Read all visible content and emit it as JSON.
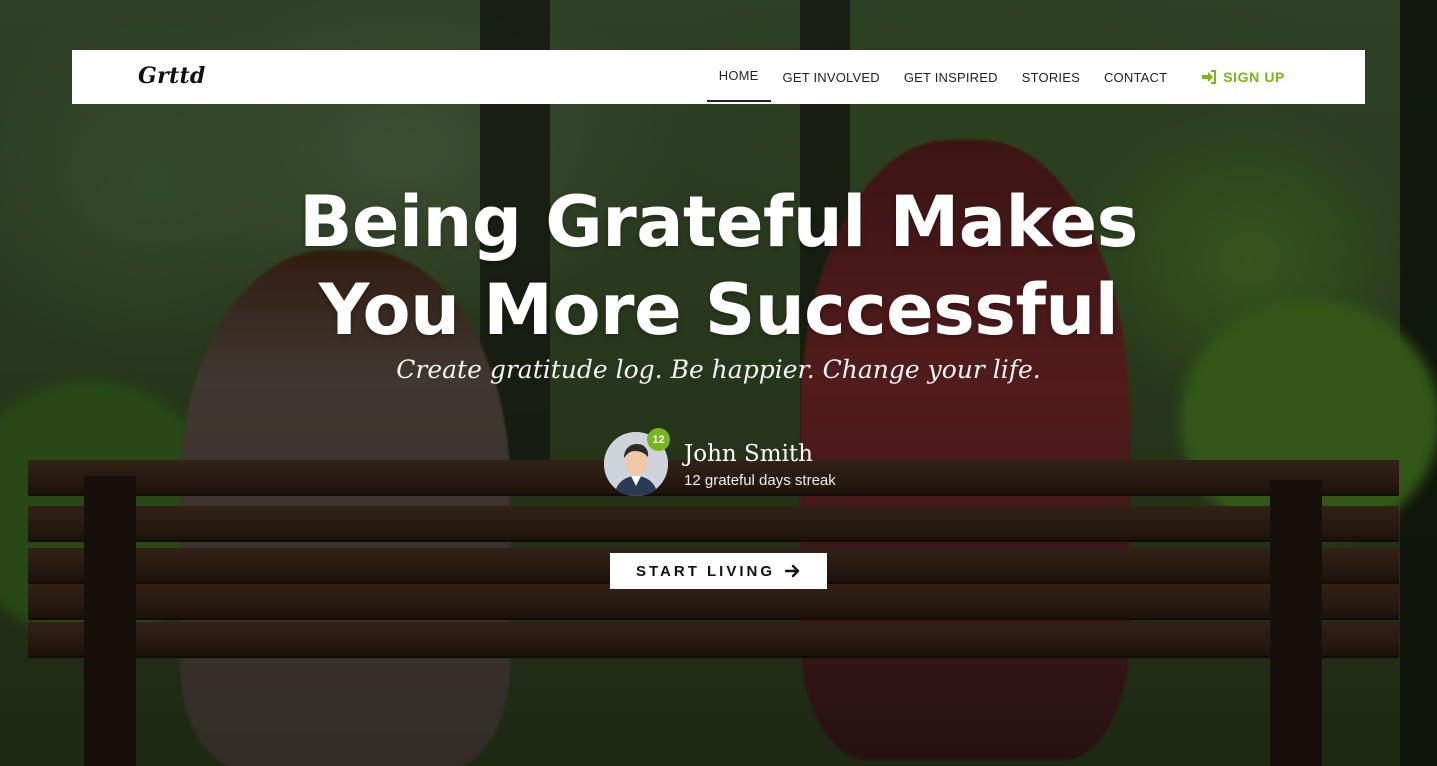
{
  "brand": "Grttd",
  "nav": {
    "items": [
      {
        "label": "HOME",
        "active": true
      },
      {
        "label": "GET INVOLVED",
        "active": false
      },
      {
        "label": "GET INSPIRED",
        "active": false
      },
      {
        "label": "STORIES",
        "active": false
      },
      {
        "label": "CONTACT",
        "active": false
      }
    ],
    "signup_label": "SIGN UP",
    "signup_icon": "sign-in-icon"
  },
  "hero": {
    "title_line1": "Being Grateful Makes",
    "title_line2": "You More Successful",
    "subtitle": "Create gratitude log. Be happier. Change your life.",
    "user": {
      "name": "John Smith",
      "streak_text": "12 grateful days streak",
      "badge": "12"
    },
    "cta_label": "START LIVING",
    "cta_icon": "arrow-right-icon"
  },
  "colors": {
    "accent": "#7ab51d",
    "navbar_bg": "#ffffff",
    "text_on_hero": "#ffffff"
  }
}
